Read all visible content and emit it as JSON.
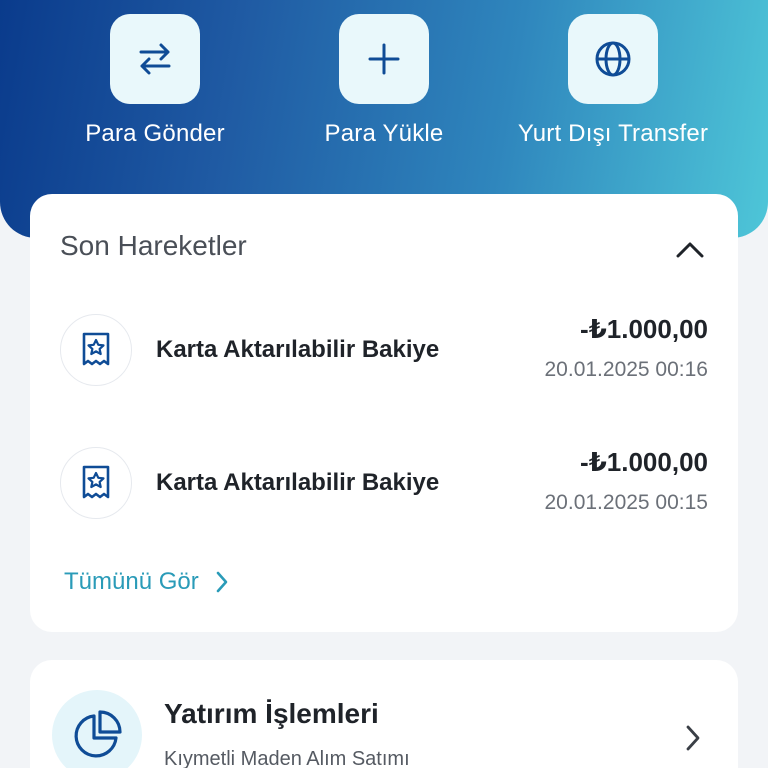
{
  "quick_actions": [
    {
      "label": "Para Gönder",
      "icon": "transfer-arrows-icon"
    },
    {
      "label": "Para Yükle",
      "icon": "plus-icon"
    },
    {
      "label": "Yurt Dışı Transfer",
      "icon": "globe-icon"
    }
  ],
  "recent": {
    "title": "Son Hareketler",
    "transactions": [
      {
        "name": "Karta Aktarılabilir Bakiye",
        "amount": "-₺1.000,00",
        "date": "20.01.2025 00:16",
        "icon": "receipt-star-icon"
      },
      {
        "name": "Karta Aktarılabilir Bakiye",
        "amount": "-₺1.000,00",
        "date": "20.01.2025 00:15",
        "icon": "receipt-star-icon"
      }
    ],
    "see_all": "Tümünü Gör"
  },
  "investment": {
    "title": "Yatırım İşlemleri",
    "subtitle": "Kıymetli Maden Alım Satımı",
    "icon": "pie-chart-icon"
  },
  "colors": {
    "primary": "#0a3b8c",
    "accent": "#2a9bb8",
    "gradient_end": "#4ec6d8",
    "icon_stroke": "#0f4c96"
  }
}
